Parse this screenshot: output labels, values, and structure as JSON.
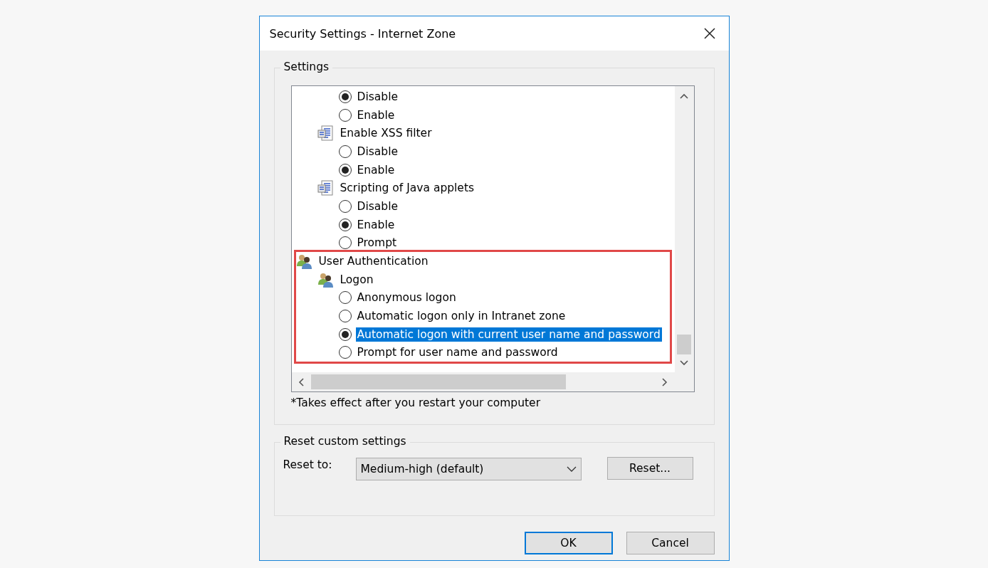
{
  "window": {
    "title": "Security Settings - Internet Zone"
  },
  "settings": {
    "legend": "Settings",
    "tree": [
      {
        "children": [
          {
            "children": [
              {
                "kind": "radio",
                "label": "Disable",
                "checked": true,
                "selected": false
              },
              {
                "kind": "radio",
                "label": "Enable",
                "checked": false,
                "selected": false
              }
            ]
          },
          {
            "kind": "script",
            "label": "Enable XSS filter",
            "children": [
              {
                "kind": "radio",
                "label": "Disable",
                "checked": false,
                "selected": false
              },
              {
                "kind": "radio",
                "label": "Enable",
                "checked": true,
                "selected": false
              }
            ]
          },
          {
            "kind": "script",
            "label": "Scripting of Java applets",
            "children": [
              {
                "kind": "radio",
                "label": "Disable",
                "checked": false,
                "selected": false
              },
              {
                "kind": "radio",
                "label": "Enable",
                "checked": true,
                "selected": false
              },
              {
                "kind": "radio",
                "label": "Prompt",
                "checked": false,
                "selected": false
              }
            ]
          }
        ]
      },
      {
        "kind": "users",
        "label": "User Authentication",
        "highlighted": true,
        "children": [
          {
            "kind": "users",
            "label": "Logon",
            "children": [
              {
                "kind": "radio",
                "label": "Anonymous logon",
                "checked": false,
                "selected": false
              },
              {
                "kind": "radio",
                "label": "Automatic logon only in Intranet zone",
                "checked": false,
                "selected": false
              },
              {
                "kind": "radio",
                "label": "Automatic logon with current user name and password",
                "checked": true,
                "selected": true
              },
              {
                "kind": "radio",
                "label": "Prompt for user name and password",
                "checked": false,
                "selected": false
              }
            ]
          }
        ]
      }
    ],
    "note": "*Takes effect after you restart your computer"
  },
  "reset": {
    "legend": "Reset custom settings",
    "label": "Reset to:",
    "dropdown": {
      "value": "Medium-high (default)"
    },
    "button": "Reset..."
  },
  "buttons": [
    {
      "label": "OK",
      "default": true
    },
    {
      "label": "Cancel",
      "default": false
    }
  ]
}
